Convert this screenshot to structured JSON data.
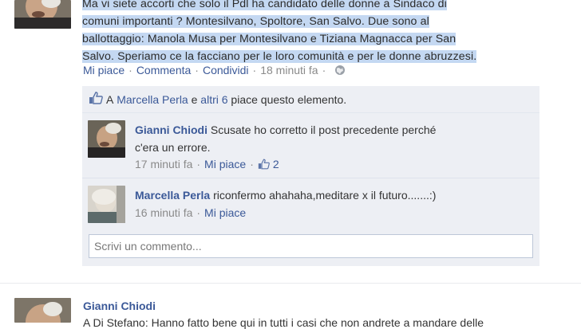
{
  "post": {
    "text_lines": [
      "Ma vi siete accorti che solo il Pdl ha candidato delle donne a Sindaco di",
      "comuni importanti ? Montesilvano, Spoltore, San Salvo. Due sono al",
      "ballottaggio: Manola Musa per Montesilvano e Tiziana Magnacca per San",
      "Salvo. Speriamo ce la facciano per le loro comunità e per le donne abruzzesi."
    ],
    "actions": {
      "like": "Mi piace",
      "comment": "Commenta",
      "share": "Condividi",
      "time": "18 minuti fa"
    }
  },
  "likes": {
    "name": "Marcella Perla",
    "connector": "e",
    "others": "altri 6",
    "suffix": "piace questo elemento.",
    "prefix": "A"
  },
  "comments": [
    {
      "author": "Gianni Chiodi",
      "line1": "Scusate ho corretto il post precedente perché",
      "line2": "c'era un errore.",
      "time": "17 minuti fa",
      "like": "Mi piace",
      "like_count": "2"
    },
    {
      "author": "Marcella Perla",
      "line1": "riconfermo ahahaha,meditare x il futuro.......:)",
      "time": "16 minuti fa",
      "like": "Mi piace"
    }
  ],
  "compose": {
    "placeholder": "Scrivi un commento..."
  },
  "next_post": {
    "author": "Gianni Chiodi",
    "text_fragment": "A Di Stefano: Hanno fatto bene qui in tutti i casi che non andrete a mandare delle"
  },
  "colors": {
    "link": "#3b5998",
    "highlight": "#c4d8f2",
    "comment_bg": "#edeff4"
  }
}
